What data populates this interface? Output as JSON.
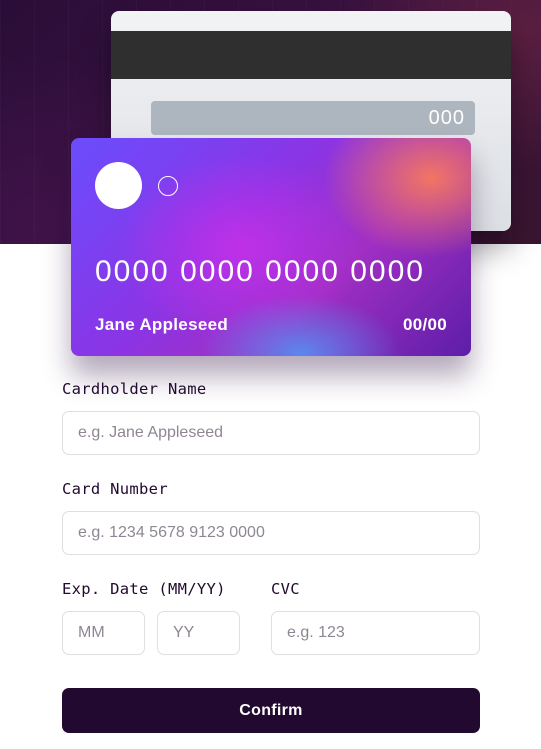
{
  "card_back": {
    "cvc_display": "000"
  },
  "card_front": {
    "number_display": "0000 0000 0000 0000",
    "name_display": "Jane Appleseed",
    "expiry_display": "00/00"
  },
  "form": {
    "cardholder_label": "Cardholder Name",
    "cardholder_placeholder": "e.g. Jane Appleseed",
    "cardholder_value": "",
    "number_label": "Card Number",
    "number_placeholder": "e.g. 1234 5678 9123 0000",
    "number_value": "",
    "expiry_label": "Exp. Date (MM/YY)",
    "month_placeholder": "MM",
    "year_placeholder": "YY",
    "cvc_label": "CVC",
    "cvc_placeholder": "e.g. 123",
    "confirm_label": "Confirm"
  },
  "colors": {
    "dark_violet": "#21092f",
    "input_border": "#dfdee0",
    "placeholder": "#8f8694",
    "card_gradient_start": "#6a4dfd",
    "card_gradient_end": "#610595"
  }
}
